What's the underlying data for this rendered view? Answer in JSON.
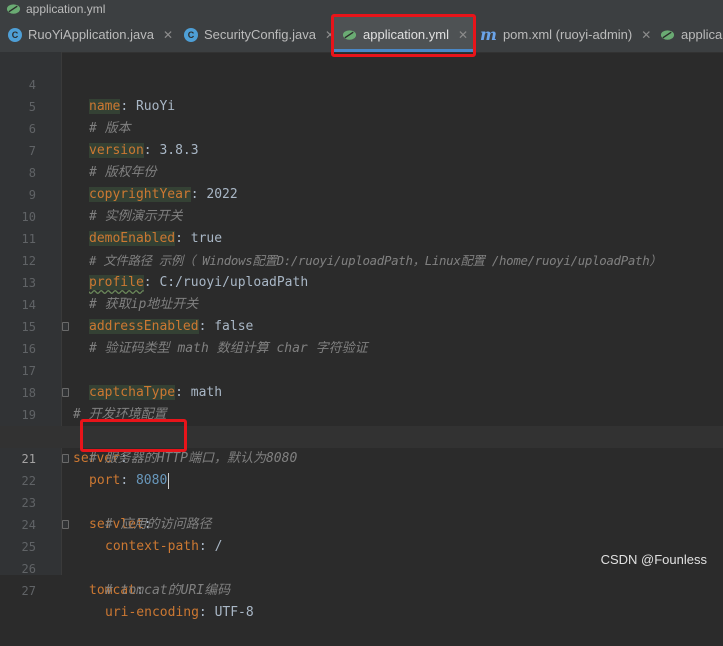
{
  "window": {
    "title": "application.yml"
  },
  "tabs": [
    {
      "label": "RuoYiApplication.java",
      "icon": "java-class-icon",
      "active": false
    },
    {
      "label": "SecurityConfig.java",
      "icon": "java-class-icon",
      "active": false
    },
    {
      "label": "application.yml",
      "icon": "spring-leaf-icon",
      "active": true
    },
    {
      "label": "pom.xml (ruoyi-admin)",
      "icon": "maven-icon",
      "active": false
    },
    {
      "label": "applica",
      "icon": "spring-leaf-icon",
      "active": false
    }
  ],
  "editor": {
    "current_line": 21,
    "lines": [
      {
        "n": "4",
        "key": "name",
        "value": "RuoYi"
      },
      {
        "n": "5",
        "comment": "# 版本"
      },
      {
        "n": "6",
        "key": "version",
        "value": "3.8.3"
      },
      {
        "n": "7",
        "comment": "# 版权年份"
      },
      {
        "n": "8",
        "key": "copyrightYear",
        "value": "2022"
      },
      {
        "n": "9",
        "comment": "# 实例演示开关"
      },
      {
        "n": "10",
        "key": "demoEnabled",
        "value": "true"
      },
      {
        "n": "11",
        "comment": "# 文件路径 示例（ Windows配置D:/ruoyi/uploadPath，Linux配置 /home/ruoyi/uploadPath）"
      },
      {
        "n": "12",
        "key": "profile",
        "value": "C:/ruoyi/uploadPath"
      },
      {
        "n": "13",
        "comment": "# 获取ip地址开关"
      },
      {
        "n": "14",
        "key": "addressEnabled",
        "value": "false"
      },
      {
        "n": "15",
        "comment": "# 验证码类型 math 数组计算 char 字符验证"
      },
      {
        "n": "16",
        "key": "captchaType",
        "value": "math"
      },
      {
        "n": "17"
      },
      {
        "n": "18",
        "comment": "# 开发环境配置"
      },
      {
        "n": "19",
        "key": "server",
        "value": ""
      },
      {
        "n": "20",
        "comment": "# 服务器的HTTP端口，默认为8080"
      },
      {
        "n": "21",
        "key": "port",
        "value": "8080"
      },
      {
        "n": "22",
        "key": "servlet",
        "value": ""
      },
      {
        "n": "23",
        "comment": "# 应用的访问路径"
      },
      {
        "n": "24",
        "key": "context-path",
        "value": "/"
      },
      {
        "n": "25",
        "key": "tomcat",
        "value": ""
      },
      {
        "n": "26",
        "comment": "# tomcat的URI编码"
      },
      {
        "n": "27",
        "key": "uri-encoding",
        "value": "UTF-8"
      }
    ]
  },
  "watermark": "CSDN @Founless",
  "colors": {
    "keyword": "#cc7832",
    "comment": "#808080",
    "value": "#a9b7c6",
    "highlight_box": "#e8141a",
    "active_tab_underline": "#4a88c7"
  }
}
